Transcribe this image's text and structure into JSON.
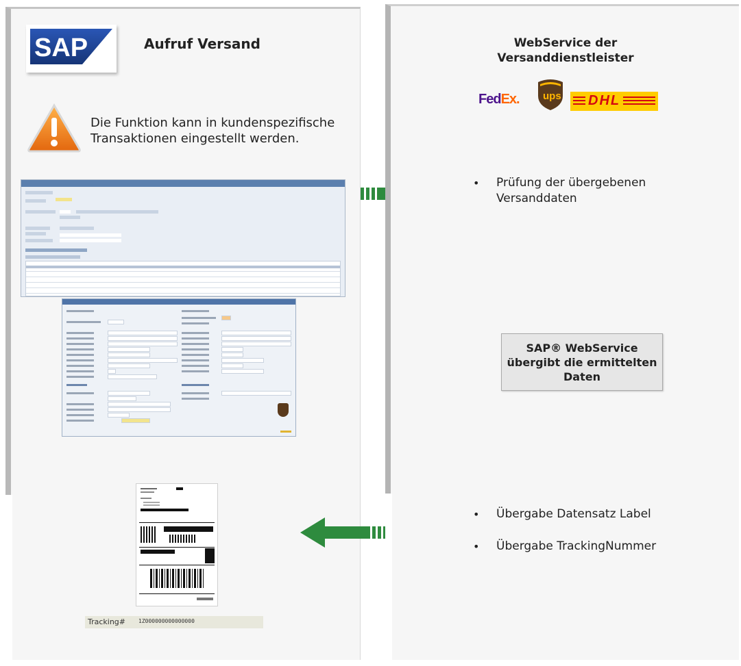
{
  "left": {
    "title": "Aufruf Versand",
    "logo_text": "SAP",
    "warning_text": "Die Funktion kann in kundenspezifische Transaktionen eingestellt werden.",
    "warning_icon": "warning-triangle-icon",
    "tracking_label": "Tracking#",
    "tracking_value": "1Z000000000000000"
  },
  "right": {
    "title": "WebService der Versanddienstleister",
    "carriers": [
      "FedEx",
      "UPS",
      "DHL"
    ],
    "bullet_check": "Prüfung der übergebenen Versanddaten",
    "webservice_box": "SAP® WebService übergibt die ermittelten Daten",
    "bullet_label": "Übergabe Datensatz Label",
    "bullet_tracking": "Übergabe TrackingNummer"
  },
  "colors": {
    "arrow": "#2e8b3e",
    "sap_blue": "#1d3f8f",
    "warning": "#f0821e"
  }
}
